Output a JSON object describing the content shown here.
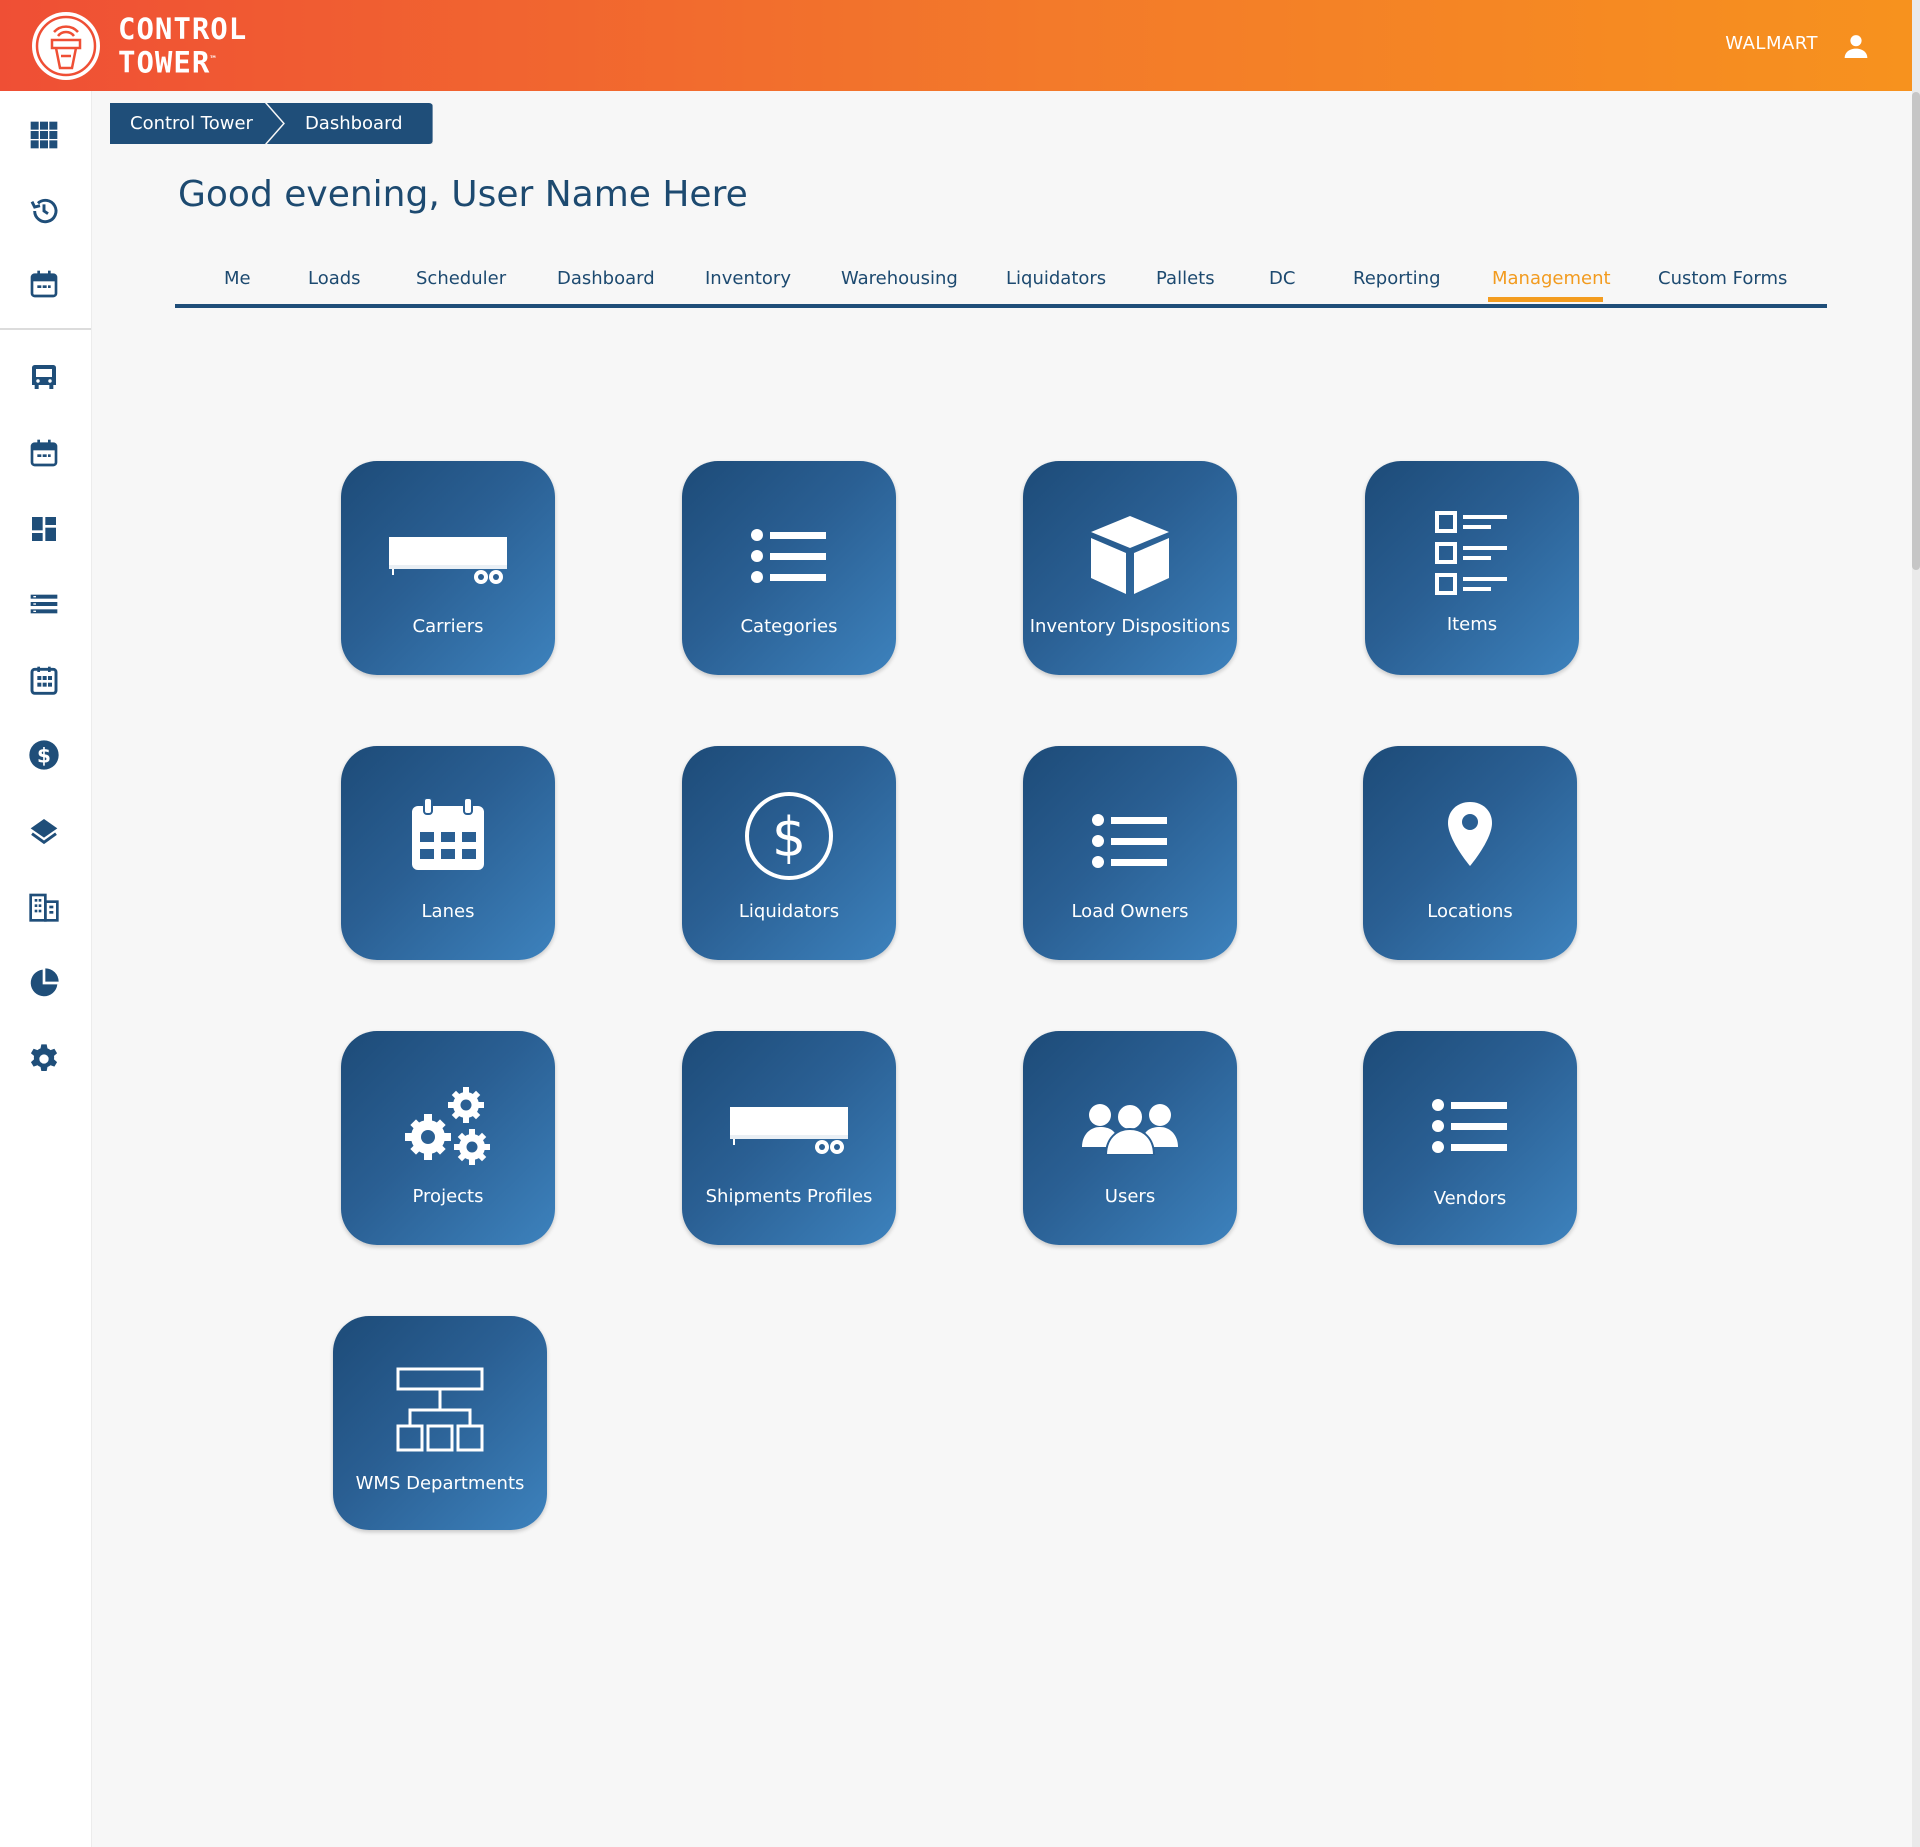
{
  "header": {
    "logo_line1": "CONTROL",
    "logo_line2": "TOWER",
    "logo_tm": "™",
    "tenant": "WALMART",
    "user_icon": "account-icon"
  },
  "sidebar": {
    "items": [
      {
        "icon": "apps-grid-icon"
      },
      {
        "icon": "history-icon"
      },
      {
        "icon": "calendar-icon"
      },
      {
        "icon": "bus-icon"
      },
      {
        "icon": "calendar-icon"
      },
      {
        "icon": "dashboard-icon"
      },
      {
        "icon": "list-icon"
      },
      {
        "icon": "calendar-grid-icon"
      },
      {
        "icon": "dollar-icon"
      },
      {
        "icon": "layers-icon"
      },
      {
        "icon": "building-icon"
      },
      {
        "icon": "pie-chart-icon"
      },
      {
        "icon": "gear-icon"
      }
    ]
  },
  "breadcrumb": {
    "items": [
      "Control Tower",
      "Dashboard"
    ]
  },
  "greeting": "Good evening, User Name Here",
  "tabs": {
    "items": [
      "Me",
      "Loads",
      "Scheduler",
      "Dashboard",
      "Inventory",
      "Warehousing",
      "Liquidators",
      "Pallets",
      "DC",
      "Reporting",
      "Management",
      "Custom Forms"
    ],
    "active": "Management"
  },
  "tiles": [
    {
      "label": "Carriers",
      "icon": "trailer-icon"
    },
    {
      "label": "Categories",
      "icon": "list-icon"
    },
    {
      "label": "Inventory Dispositions",
      "icon": "box-icon"
    },
    {
      "label": "Items",
      "icon": "checklist-icon"
    },
    {
      "label": "Lanes",
      "icon": "calendar-icon"
    },
    {
      "label": "Liquidators",
      "icon": "dollar-circle-icon"
    },
    {
      "label": "Load Owners",
      "icon": "list-icon"
    },
    {
      "label": "Locations",
      "icon": "map-pin-icon"
    },
    {
      "label": "Projects",
      "icon": "gears-icon"
    },
    {
      "label": "Shipments Profiles",
      "icon": "trailer-icon"
    },
    {
      "label": "Users",
      "icon": "users-icon"
    },
    {
      "label": "Vendors",
      "icon": "list-icon"
    },
    {
      "label": "WMS Departments",
      "icon": "org-chart-icon"
    }
  ],
  "colors": {
    "header_start": "#ef4f35",
    "header_end": "#f7921e",
    "primary": "#1f4e79",
    "accent": "#f39c1f"
  }
}
